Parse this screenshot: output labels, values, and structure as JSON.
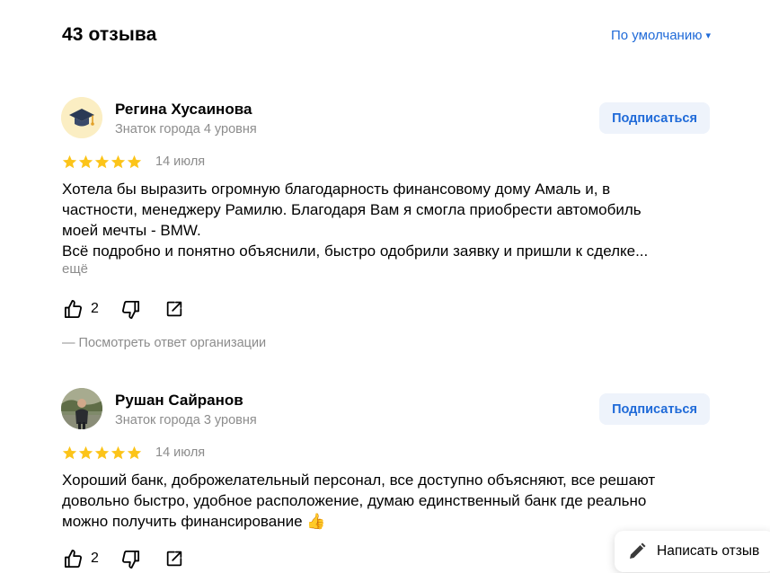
{
  "header": {
    "count_title": "43 отзыва",
    "sort_label": "По умолчанию",
    "sort_caret": "▾"
  },
  "reviews": [
    {
      "author": "Регина Хусаинова",
      "level": "Знаток города 4 уровня",
      "subscribe_label": "Подписаться",
      "rating": 5,
      "date": "14 июля",
      "text_lines": [
        "Хотела бы выразить огромную благодарность финансовому дому Амаль и, в",
        "частности, менеджеру Рамилю. Благодаря Вам я смогла приобрести автомобиль",
        "моей мечты - BMW.",
        "Всё подробно и понятно объяснили, быстро одобрили заявку и пришли к сделке..."
      ],
      "more_label": "ещё",
      "likes": "2",
      "org_reply_label": "— Посмотреть ответ организации",
      "avatar_icon": "graduation-cap-icon"
    },
    {
      "author": "Рушан Сайранов",
      "level": "Знаток города 3 уровня",
      "subscribe_label": "Подписаться",
      "rating": 5,
      "date": "14 июля",
      "text_lines": [
        "Хороший банк, доброжелательный персонал, все доступно объясняют, все решают",
        "довольно быстро, удобное расположение, думаю единственный банк где реально",
        "можно получить финансирование 👍"
      ],
      "likes": "2",
      "avatar_icon": "user-photo"
    }
  ],
  "write_review": {
    "label": "Написать отзыв",
    "icon": "pencil-icon"
  },
  "colors": {
    "accent": "#1f6ad8",
    "star": "#fcc419",
    "muted": "#8c8c8c",
    "button_bg": "#eef3fb"
  }
}
